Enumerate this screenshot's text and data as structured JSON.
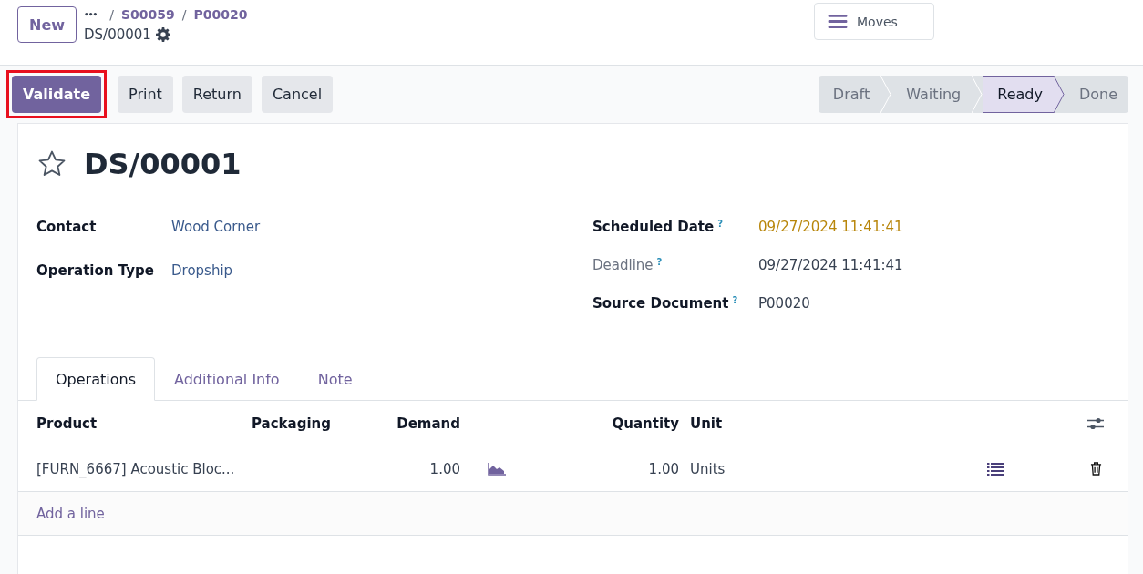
{
  "top_bar": {
    "new_button": "New",
    "breadcrumb": {
      "more": "•••",
      "separator": "/",
      "items": [
        "S00059",
        "P00020"
      ],
      "current": "DS/00001"
    },
    "moves_button": "Moves"
  },
  "actions": [
    {
      "label": "Validate",
      "primary": true,
      "highlighted": true
    },
    {
      "label": "Print",
      "primary": false,
      "highlighted": false
    },
    {
      "label": "Return",
      "primary": false,
      "highlighted": false
    },
    {
      "label": "Cancel",
      "primary": false,
      "highlighted": false
    }
  ],
  "status_steps": [
    {
      "label": "Draft",
      "selected": false
    },
    {
      "label": "Waiting",
      "selected": false
    },
    {
      "label": "Ready",
      "selected": true
    },
    {
      "label": "Done",
      "selected": false
    }
  ],
  "record": {
    "title": "DS/00001",
    "starred": false
  },
  "left_fields": [
    {
      "label": "Contact",
      "value": "Wood Corner",
      "muted": false,
      "warning": false
    },
    {
      "label": "Operation Type",
      "value": "Dropship",
      "muted": false,
      "warning": false
    }
  ],
  "right_fields": [
    {
      "label": "Scheduled Date",
      "help": "?",
      "value": "09/27/2024 11:41:41",
      "muted": false,
      "warning": true
    },
    {
      "label": "Deadline",
      "help": "?",
      "value": "09/27/2024 11:41:41",
      "muted": true,
      "warning": false
    },
    {
      "label": "Source Document",
      "help": "?",
      "value": "P00020",
      "muted": false,
      "warning": false
    }
  ],
  "tabs": [
    {
      "label": "Operations",
      "selected": true
    },
    {
      "label": "Additional Info",
      "selected": false
    },
    {
      "label": "Note",
      "selected": false
    }
  ],
  "table": {
    "columns": [
      "Product",
      "Packaging",
      "Demand",
      "Quantity",
      "Unit"
    ],
    "rows": [
      {
        "product": "[FURN_6667] Acoustic Bloc...",
        "demand": "1.00",
        "quantity": "1.00",
        "unit": "Units"
      }
    ],
    "add_line": "Add a line"
  }
}
